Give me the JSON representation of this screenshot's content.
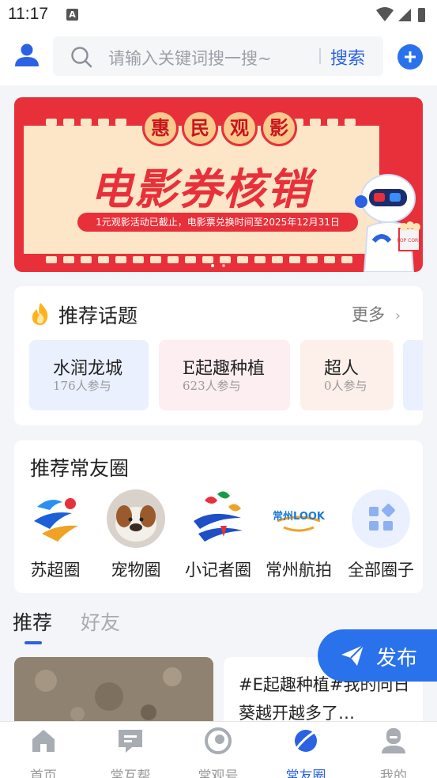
{
  "status": {
    "time": "11:17",
    "a_icon": "A"
  },
  "header": {
    "search_placeholder": "请输入关键词搜一搜~",
    "search_button": "搜索"
  },
  "banner": {
    "circle_chars": [
      "惠",
      "民",
      "观",
      "影"
    ],
    "headline": "电影券核销",
    "note": "1元观影活动已截止，电影票兑换时间至2025年12月31日",
    "popcorn_text": "POP CORN"
  },
  "topics": {
    "title": "推荐话题",
    "more": "更多",
    "items": [
      {
        "name": "水润龙城",
        "count": "176人参与",
        "bg": "#eaf0fd"
      },
      {
        "name": "E起趣种植",
        "count": "623人参与",
        "bg": "#fdeef2"
      },
      {
        "name": "超人",
        "count": "0人参与",
        "bg": "#fdf0ea"
      }
    ]
  },
  "circles": {
    "title": "推荐常友圈",
    "items": [
      {
        "label": "苏超圈",
        "icon": "su-chao-logo-icon"
      },
      {
        "label": "宠物圈",
        "icon": "pet-dog-icon"
      },
      {
        "label": "小记者圈",
        "icon": "reporter-logo-icon"
      },
      {
        "label": "常州航拍",
        "icon": "changzhou-look-logo-icon",
        "logo_text": "常州LOOK"
      },
      {
        "label": "全部圈子",
        "icon": "grid-apps-icon"
      }
    ]
  },
  "feed": {
    "tabs": [
      "推荐",
      "好友"
    ],
    "post_text": "#E起趣种植#我的向日葵越开越多了…"
  },
  "publish": {
    "label": "发布"
  },
  "nav": [
    {
      "label": "首页",
      "icon": "home-icon"
    },
    {
      "label": "常互帮",
      "icon": "message-icon"
    },
    {
      "label": "常观号",
      "icon": "compass-icon"
    },
    {
      "label": "常友圈",
      "icon": "planet-icon",
      "active": true
    },
    {
      "label": "我的",
      "icon": "profile-icon"
    }
  ],
  "colors": {
    "accent": "#2a62e3",
    "banner_red": "#e8303a",
    "nav_inactive": "#999999"
  }
}
